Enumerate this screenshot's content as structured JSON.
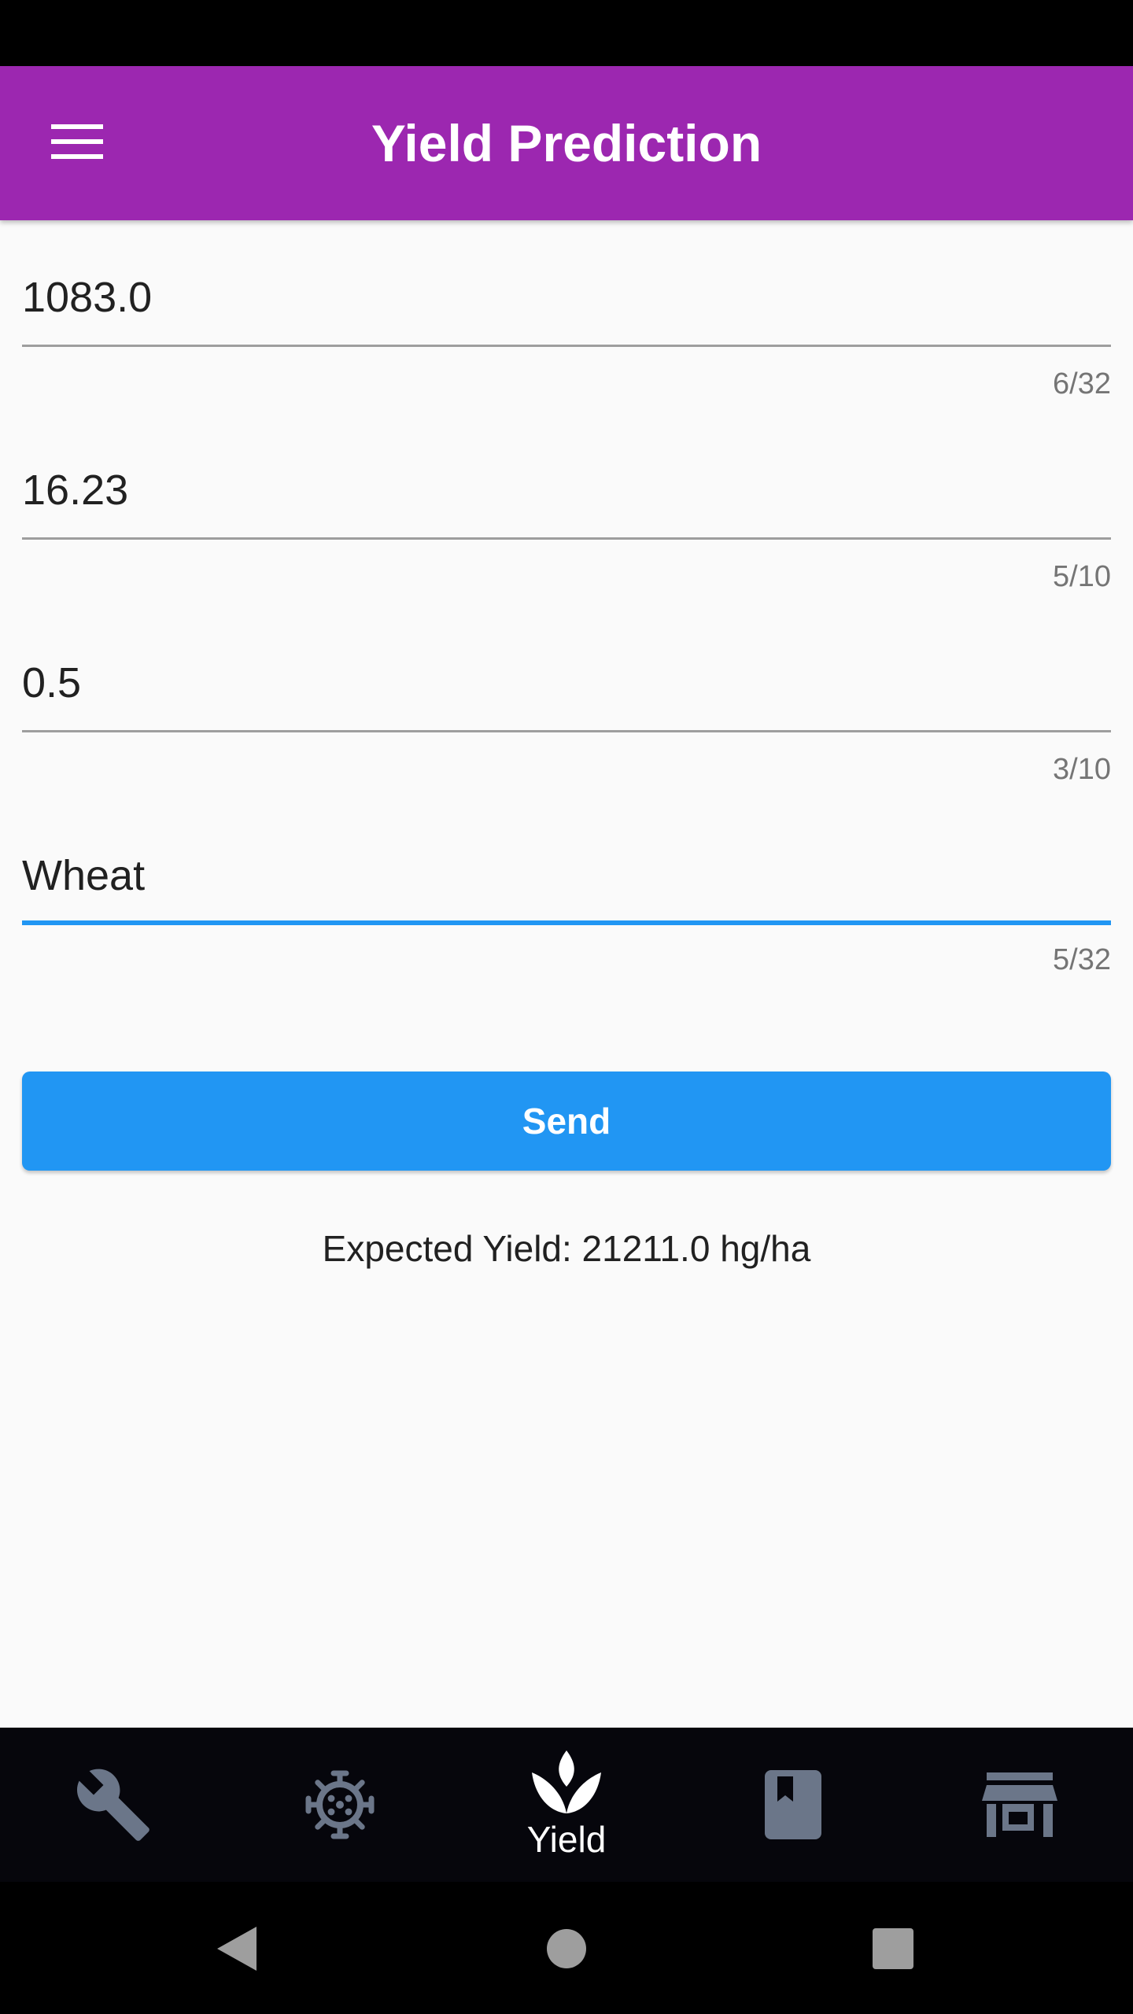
{
  "app_bar": {
    "title": "Yield Prediction",
    "background": "#9c27b0",
    "menu_icon": "menu-icon"
  },
  "form": {
    "fields": [
      {
        "value": "1083.0",
        "counter": "6/32",
        "focused": false
      },
      {
        "value": "16.23",
        "counter": "5/10",
        "focused": false
      },
      {
        "value": "0.5",
        "counter": "3/10",
        "focused": false
      },
      {
        "value": "Wheat",
        "counter": "5/32",
        "focused": true
      }
    ],
    "send_label": "Send",
    "accent": "#2196f3"
  },
  "result": {
    "text": "Expected Yield: 21211.0 hg/ha"
  },
  "bottom_nav": {
    "items": [
      {
        "icon": "wrench-icon",
        "label": "",
        "selected": false
      },
      {
        "icon": "virus-icon",
        "label": "",
        "selected": false
      },
      {
        "icon": "sprout-icon",
        "label": "Yield",
        "selected": true
      },
      {
        "icon": "book-icon",
        "label": "",
        "selected": false
      },
      {
        "icon": "store-icon",
        "label": "",
        "selected": false
      }
    ],
    "inactive_color": "#6b7689",
    "active_color": "#ffffff"
  },
  "system_nav": {
    "buttons": [
      "back-icon",
      "home-icon",
      "recents-icon"
    ]
  }
}
